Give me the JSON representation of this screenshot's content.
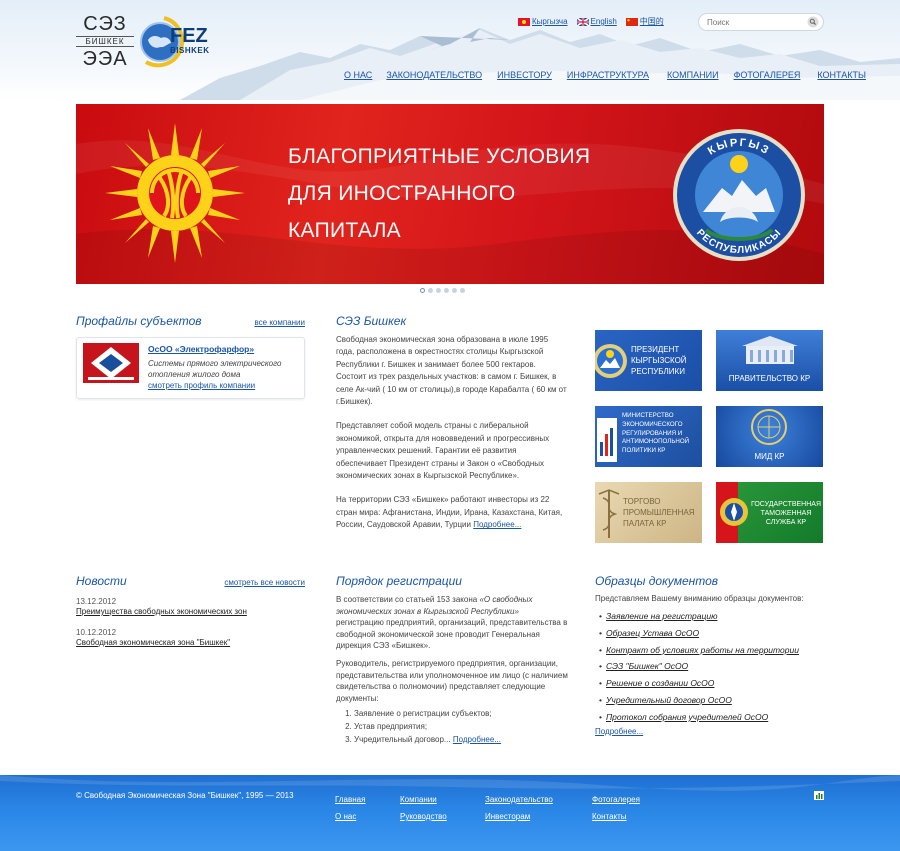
{
  "header": {
    "logo_ru_top": "СЭЗ",
    "logo_ru_middle": "БИШКЕК",
    "logo_ru_bottom": "ЭЭА",
    "logo_en_top": "FEZ",
    "logo_en_bottom": "BISHKEK",
    "languages": [
      {
        "label": "Кыргызча",
        "flag": "flag-kyrgyzstan-icon"
      },
      {
        "label": "English",
        "flag": "flag-uk-icon"
      },
      {
        "label": "中国的",
        "flag": "flag-china-icon"
      }
    ],
    "search_placeholder": "Поиск",
    "nav": [
      "О нас",
      "Законодательство",
      "Инвестору",
      "Инфраструктура",
      "Компании",
      "Фотогалерея",
      "Контакты"
    ]
  },
  "banner": {
    "line1": "БЛАГОПРИЯТНЫЕ УСЛОВИЯ",
    "line2": "ДЛЯ ИНОСТРАННОГО",
    "line3": "КАПИТАЛА",
    "emblem_top": "КЫРГЫЗ",
    "emblem_bottom": "РЕСПУБЛИКАСЫ",
    "slides": 6,
    "active_slide": 1
  },
  "profiles": {
    "title": "Профайлы субъектов",
    "all_link": "все компании",
    "company_name": "ОсОО «Электрофарфор»",
    "company_desc": "Системы прямого электрического отопления жилого дома",
    "company_link": "смотреть профиль компании"
  },
  "about": {
    "title": "СЭЗ Бишкек",
    "p1": "Свободная экономическая зона образована в июле 1995 года, расположена в окрестностях столицы Кыргызской Республики г. Бишкек и занимает более 500 гектаров. Состоит из трех раздельных участков: в самом г. Бишкек, в селе Ак-чий ( 10 км от столицы),в городе Карабалта ( 60 км от г.Бишкек).",
    "p2": "Представляет собой модель страны с либеральной экономикой, открыта для нововведений и прогрессивных управленческих решений. Гарантии её развития обеспечивает Президент страны и Закон о «Свободных экономических зонах в Кыргызской Республике».",
    "p3": "На территории СЭЗ «Бишкек» работают инвесторы из 22 стран мира: Афганистана, Индии, Ирана, Казахстана, Китая, России, Саудовской Аравии, Турции",
    "more": "Подробнее..."
  },
  "partners": [
    {
      "label": "ПРЕЗИДЕНТ КЫРГЫЗСКОЙ РЕСПУБЛИКИ"
    },
    {
      "label": "ПРАВИТЕЛЬСТВО КР"
    },
    {
      "label": "МИНИСТЕРСТВО ЭКОНОМИЧЕСКОГО РЕГУЛИРОВАНИЯ И АНТИМОНОПОЛЬНОЙ ПОЛИТИКИ КР"
    },
    {
      "label": "МИД КР"
    },
    {
      "label": "ТОРГОВО ПРОМЫШЛЕННАЯ ПАЛАТА КР"
    },
    {
      "label": "ГОСУДАРСТВЕННАЯ ТАМОЖЕННАЯ СЛУЖБА КР"
    }
  ],
  "news": {
    "title": "Новости",
    "all_link": "смотреть все новости",
    "items": [
      {
        "date": "13.12.2012",
        "title": "Преимущества свободных экономических зон"
      },
      {
        "date": "10.12.2012",
        "title": "Свободная экономическая зона \"Бишкек\""
      }
    ]
  },
  "registration": {
    "title": "Порядок регистрации",
    "p1_before": "В соответствии со статьей 153 закона ",
    "p1_italic": "«О свободных экономических зонах в Кыргызской Республики»",
    "p1_after": " регистрацию предприятий, организаций, представительства в свободной экономической зоне проводит Генеральная дирекция СЭЗ «Бишкек».",
    "p2": "Руководитель, регистрируемого предприятия, организации, представительства или уполномоченное им лицо (с наличием свидетельства о полномочии) представляет следующие документы:",
    "list": [
      "Заявление о регистрации субъектов;",
      "Устав предприятия;",
      "Учредительный договор..."
    ],
    "more": "Подробнее..."
  },
  "documents": {
    "title": "Образцы документов",
    "intro": "Представляем Вашему вниманию образцы документов:",
    "items": [
      "Заявление на регистрацию",
      "Образец Устава ОсОО",
      "Контракт об условиях работы на территории",
      "СЭЗ \"Бишкек\" ОсОО",
      "Решение о создании ОсОО",
      "Учредительный договор ОсОО",
      "Протокол собрания учредителей ОсОО"
    ],
    "more": "Подробнее..."
  },
  "footer": {
    "copyright": "© Свободная Экономическая Зона \"Бишкек\", 1995 — 2013",
    "col1": [
      "Главная",
      "О нас"
    ],
    "col2": [
      "Компании",
      "Руководство"
    ],
    "col3": [
      "Законодательство",
      "Инвесторам"
    ],
    "col4": [
      "Фотогалерея",
      "Контакты"
    ],
    "counter_icon": "liveinternet-counter-icon"
  }
}
